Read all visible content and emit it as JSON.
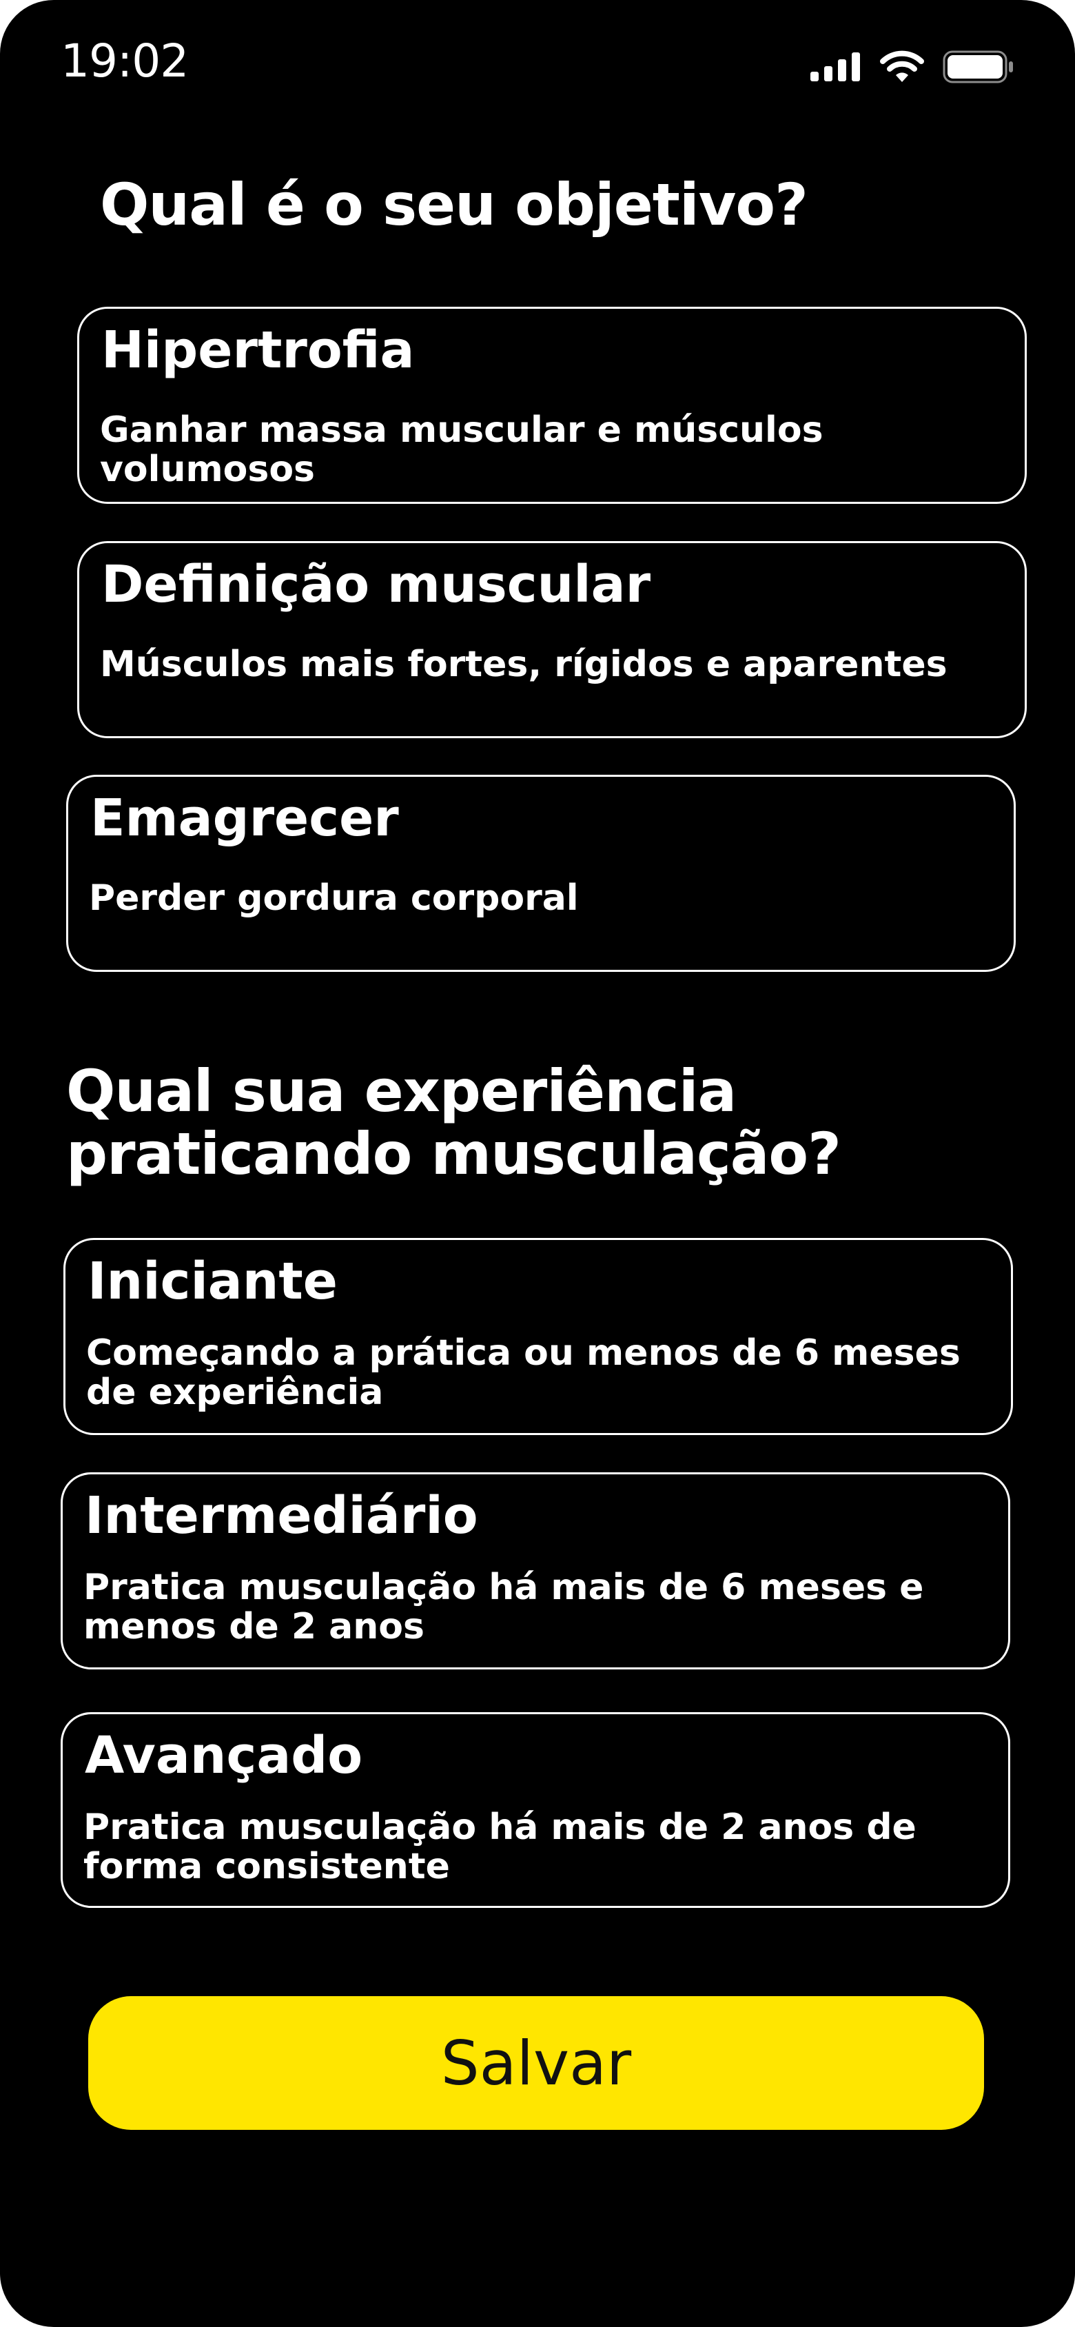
{
  "status_bar": {
    "time": "19:02",
    "icons": [
      "cellular-signal-icon",
      "wifi-icon",
      "battery-icon"
    ]
  },
  "goal_section": {
    "title": "Qual é o seu objetivo?",
    "options": [
      {
        "title": "Hipertrofia",
        "description": "Ganhar massa muscular e músculos volumosos"
      },
      {
        "title": "Definição muscular",
        "description": "Músculos mais fortes, rígidos e aparentes"
      },
      {
        "title": "Emagrecer",
        "description": "Perder gordura corporal"
      }
    ]
  },
  "experience_section": {
    "title": "Qual sua experiência praticando musculação?",
    "options": [
      {
        "title": "Iniciante",
        "description": "Começando a prática ou menos de 6 meses de experiência"
      },
      {
        "title": "Intermediário",
        "description": "Pratica musculação há mais de 6 meses e menos de 2 anos"
      },
      {
        "title": "Avançado",
        "description": "Pratica musculação há mais de 2 anos de forma consistente"
      }
    ]
  },
  "save_button": {
    "label": "Salvar"
  },
  "colors": {
    "background": "#000000",
    "text": "#ffffff",
    "option_border": "#ffffff",
    "accent": "#ffe600",
    "button_text": "#111111"
  }
}
